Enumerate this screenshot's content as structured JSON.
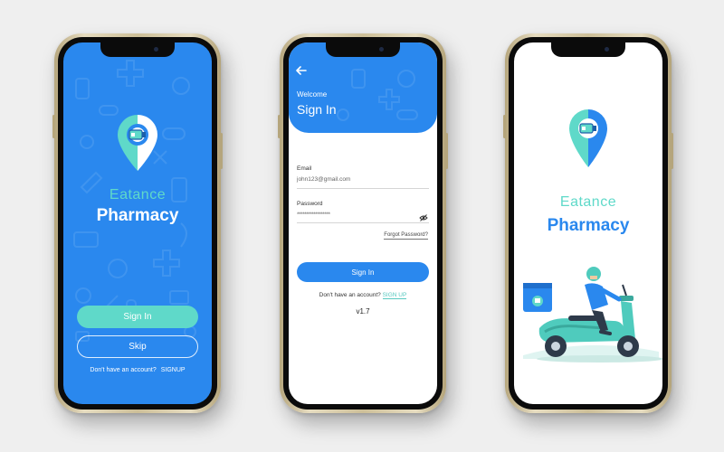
{
  "colors": {
    "primary_blue": "#2a88ee",
    "accent_teal": "#5fd9c9",
    "background": "#efefef"
  },
  "splash_screen": {
    "brand_name": "Eatance",
    "brand_product": "Pharmacy",
    "sign_in_button": "Sign In",
    "skip_button": "Skip",
    "no_account_text": "Don't have an account?",
    "signup_link": "SIGNUP"
  },
  "signin_screen": {
    "back_icon": "back-arrow-icon",
    "welcome_text": "Welcome",
    "title": "Sign In",
    "email_label": "Email",
    "email_value": "john123@gmail.com",
    "password_label": "Password",
    "password_value": "******************",
    "password_toggle_icon": "eye-off-icon",
    "forgot_password": "Forgot Password?",
    "sign_in_button": "Sign In",
    "no_account_text": "Don't have an account?",
    "signup_link": "SIGN UP",
    "version": "v1.7"
  },
  "delivery_screen": {
    "brand_name": "Eatance",
    "brand_product": "Pharmacy",
    "illustration": "delivery-scooter-illustration"
  }
}
